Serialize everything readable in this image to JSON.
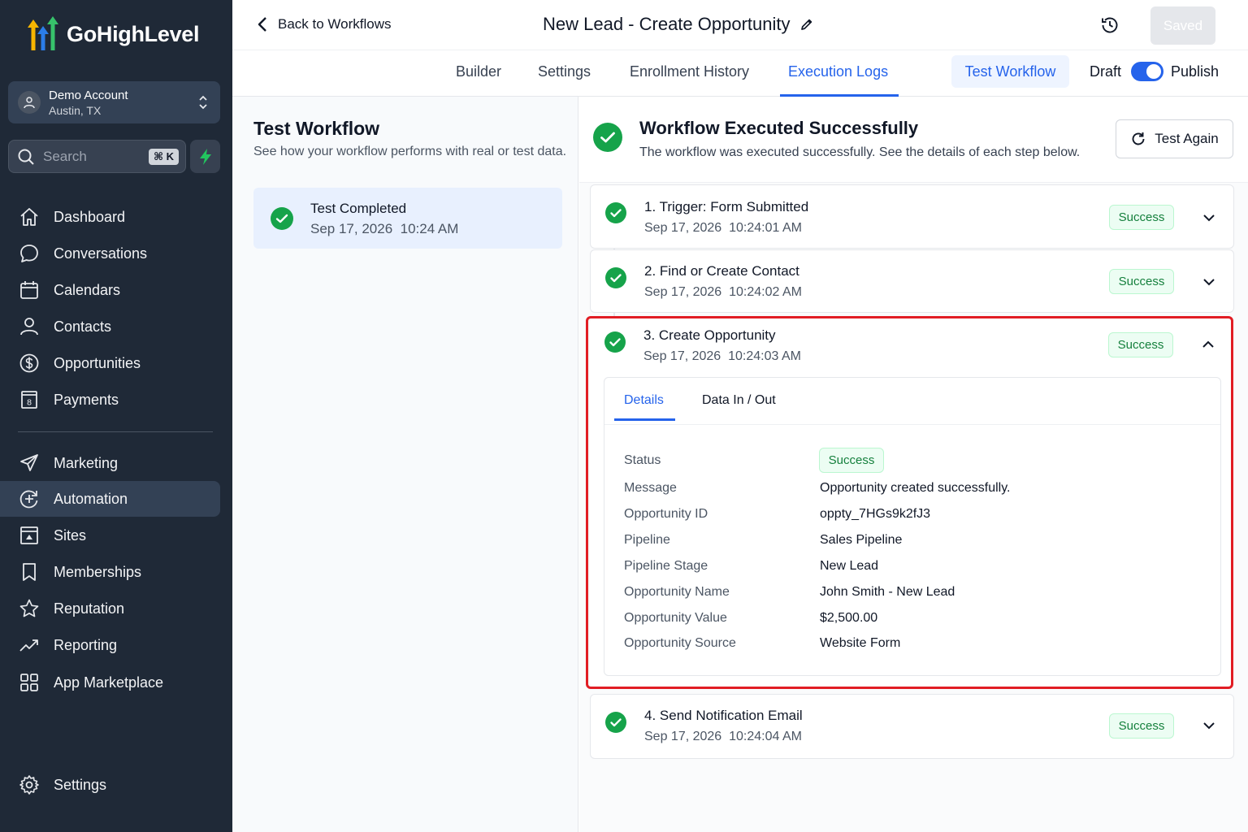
{
  "brand": {
    "name": "GoHighLevel"
  },
  "account": {
    "name": "Demo Account",
    "location": "Austin, TX"
  },
  "search": {
    "placeholder": "Search",
    "shortcut": "⌘ K"
  },
  "sidebar": {
    "items": [
      {
        "label": "Dashboard",
        "icon": "home-icon"
      },
      {
        "label": "Conversations",
        "icon": "chat-icon"
      },
      {
        "label": "Calendars",
        "icon": "calendar-icon"
      },
      {
        "label": "Contacts",
        "icon": "user-icon"
      },
      {
        "label": "Opportunities",
        "icon": "dollar-icon"
      },
      {
        "label": "Payments",
        "icon": "receipt-icon"
      },
      {
        "label": "Marketing",
        "icon": "send-icon"
      },
      {
        "label": "Automation",
        "icon": "automation-icon",
        "active": true
      },
      {
        "label": "Sites",
        "icon": "sites-icon"
      },
      {
        "label": "Memberships",
        "icon": "bookmark-icon"
      },
      {
        "label": "Reputation",
        "icon": "star-icon"
      },
      {
        "label": "Reporting",
        "icon": "trend-icon"
      },
      {
        "label": "App Marketplace",
        "icon": "grid-icon"
      }
    ],
    "footer": {
      "label": "Settings",
      "icon": "gear-icon"
    }
  },
  "header": {
    "back_label": "Back to Workflows",
    "workflow_title": "New Lead - Create Opportunity",
    "saved_label": "Saved"
  },
  "tabs": {
    "items": [
      "Builder",
      "Settings",
      "Enrollment History",
      "Execution Logs"
    ],
    "active": "Execution Logs",
    "test_workflow_label": "Test Workflow",
    "draft_label": "Draft",
    "publish_label": "Publish",
    "published": true
  },
  "left": {
    "title": "Test Workflow",
    "subtitle": "See how your workflow performs with real or test data.",
    "run": {
      "title": "Test Completed",
      "date": "Sep 17, 2026",
      "time": "10:24 AM"
    }
  },
  "result": {
    "title": "Workflow Executed Successfully",
    "subtitle": "The workflow was executed successfully. See the details of each step below.",
    "test_again_label": "Test Again"
  },
  "steps": [
    {
      "title": "1. Trigger: Form Submitted",
      "date": "Sep 17, 2026",
      "time": "10:24:01 AM",
      "status": "Success",
      "expanded": false
    },
    {
      "title": "2. Find or Create Contact",
      "date": "Sep 17, 2026",
      "time": "10:24:02 AM",
      "status": "Success",
      "expanded": false
    },
    {
      "title": "3. Create Opportunity",
      "date": "Sep 17, 2026",
      "time": "10:24:03 AM",
      "status": "Success",
      "expanded": true
    },
    {
      "title": "4. Send Notification Email",
      "date": "Sep 17, 2026",
      "time": "10:24:04 AM",
      "status": "Success",
      "expanded": false
    }
  ],
  "details": {
    "tabs": [
      "Details",
      "Data In / Out"
    ],
    "active_tab": "Details",
    "rows": [
      {
        "label": "Status",
        "value": "Success",
        "badge": true
      },
      {
        "label": "Message",
        "value": "Opportunity created successfully."
      },
      {
        "label": "Opportunity ID",
        "value": "oppty_7HGs9k2fJ3"
      },
      {
        "label": "Pipeline",
        "value": "Sales Pipeline"
      },
      {
        "label": "Pipeline Stage",
        "value": "New Lead"
      },
      {
        "label": "Opportunity Name",
        "value": "John Smith - New Lead"
      },
      {
        "label": "Opportunity Value",
        "value": "$2,500.00"
      },
      {
        "label": "Opportunity Source",
        "value": "Website Form"
      }
    ]
  },
  "colors": {
    "sidebar_bg": "#1f2937",
    "accent": "#2563eb",
    "success": "#16a34a",
    "highlight": "#e11d24"
  }
}
